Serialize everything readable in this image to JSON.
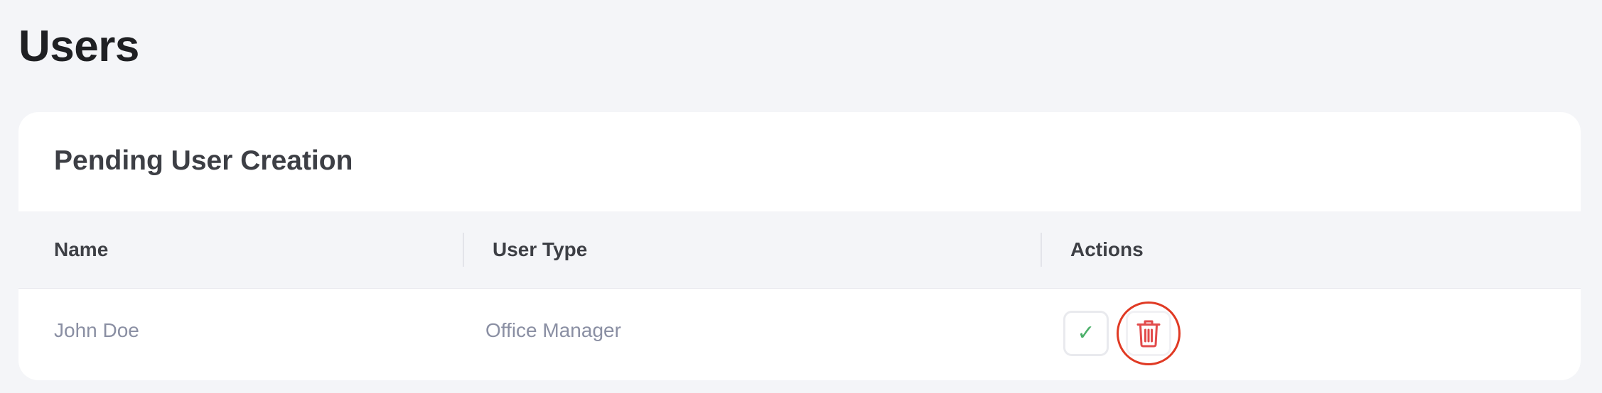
{
  "page": {
    "title": "Users"
  },
  "pending_card": {
    "title": "Pending User Creation",
    "columns": [
      "Name",
      "User Type",
      "Actions"
    ],
    "rows": [
      {
        "name": "John Doe",
        "user_type": "Office Manager",
        "actions": [
          {
            "icon": "check-icon",
            "color": "#4cb06a"
          },
          {
            "icon": "trash-icon",
            "color": "#e24b4b"
          }
        ]
      }
    ]
  },
  "colors": {
    "background": "#f4f5f8",
    "card": "#ffffff",
    "approve": "#4cb06a",
    "delete": "#e24b4b",
    "highlight_ring": "#e03a24"
  }
}
